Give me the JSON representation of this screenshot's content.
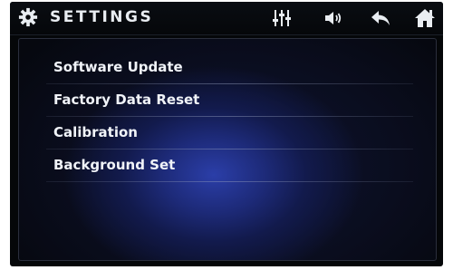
{
  "header": {
    "title": "SETTINGS",
    "icons": [
      "gear-icon",
      "equalizer-icon",
      "volume-icon",
      "back-icon",
      "home-icon"
    ]
  },
  "menu": {
    "items": [
      {
        "label": "Software Update"
      },
      {
        "label": "Factory Data Reset"
      },
      {
        "label": "Calibration"
      },
      {
        "label": "Background Set"
      }
    ]
  },
  "colors": {
    "background": "#050709",
    "accent_blue": "#2b3ea8",
    "text": "#f0f3f8"
  }
}
